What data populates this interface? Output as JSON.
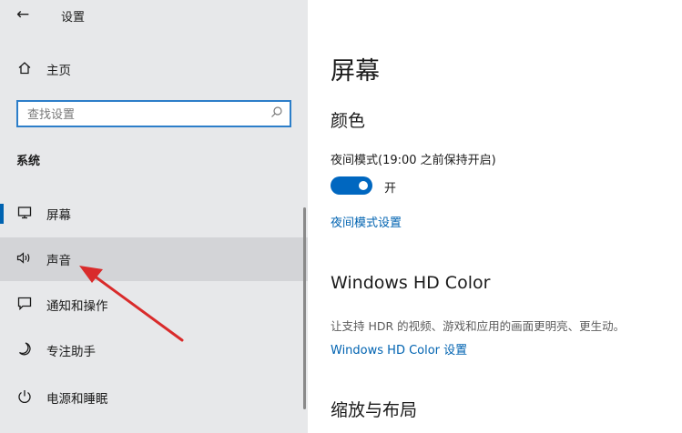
{
  "window": {
    "title": "设置"
  },
  "sidebar": {
    "home_label": "主页",
    "search": {
      "placeholder": "查找设置",
      "value": ""
    },
    "section_label": "系统",
    "items": [
      {
        "label": "屏幕",
        "icon": "monitor-icon",
        "selected": true
      },
      {
        "label": "声音",
        "icon": "speaker-icon",
        "hovered": true
      },
      {
        "label": "通知和操作",
        "icon": "notification-icon"
      },
      {
        "label": "专注助手",
        "icon": "moon-icon"
      },
      {
        "label": "电源和睡眠",
        "icon": "power-icon"
      }
    ]
  },
  "main": {
    "title": "屏幕",
    "color_heading": "颜色",
    "night_light": {
      "label": "夜间模式(19:00 之前保持开启)",
      "toggle_on": true,
      "state_label": "开",
      "settings_link": "夜间模式设置"
    },
    "hdr": {
      "heading": "Windows HD Color",
      "description": "让支持 HDR 的视频、游戏和应用的画面更明亮、更生动。",
      "link": "Windows HD Color 设置"
    },
    "scale_heading": "缩放与布局"
  },
  "colors": {
    "accent": "#0067c0",
    "link": "#0063b1",
    "annotation_arrow": "#d92b2b"
  }
}
